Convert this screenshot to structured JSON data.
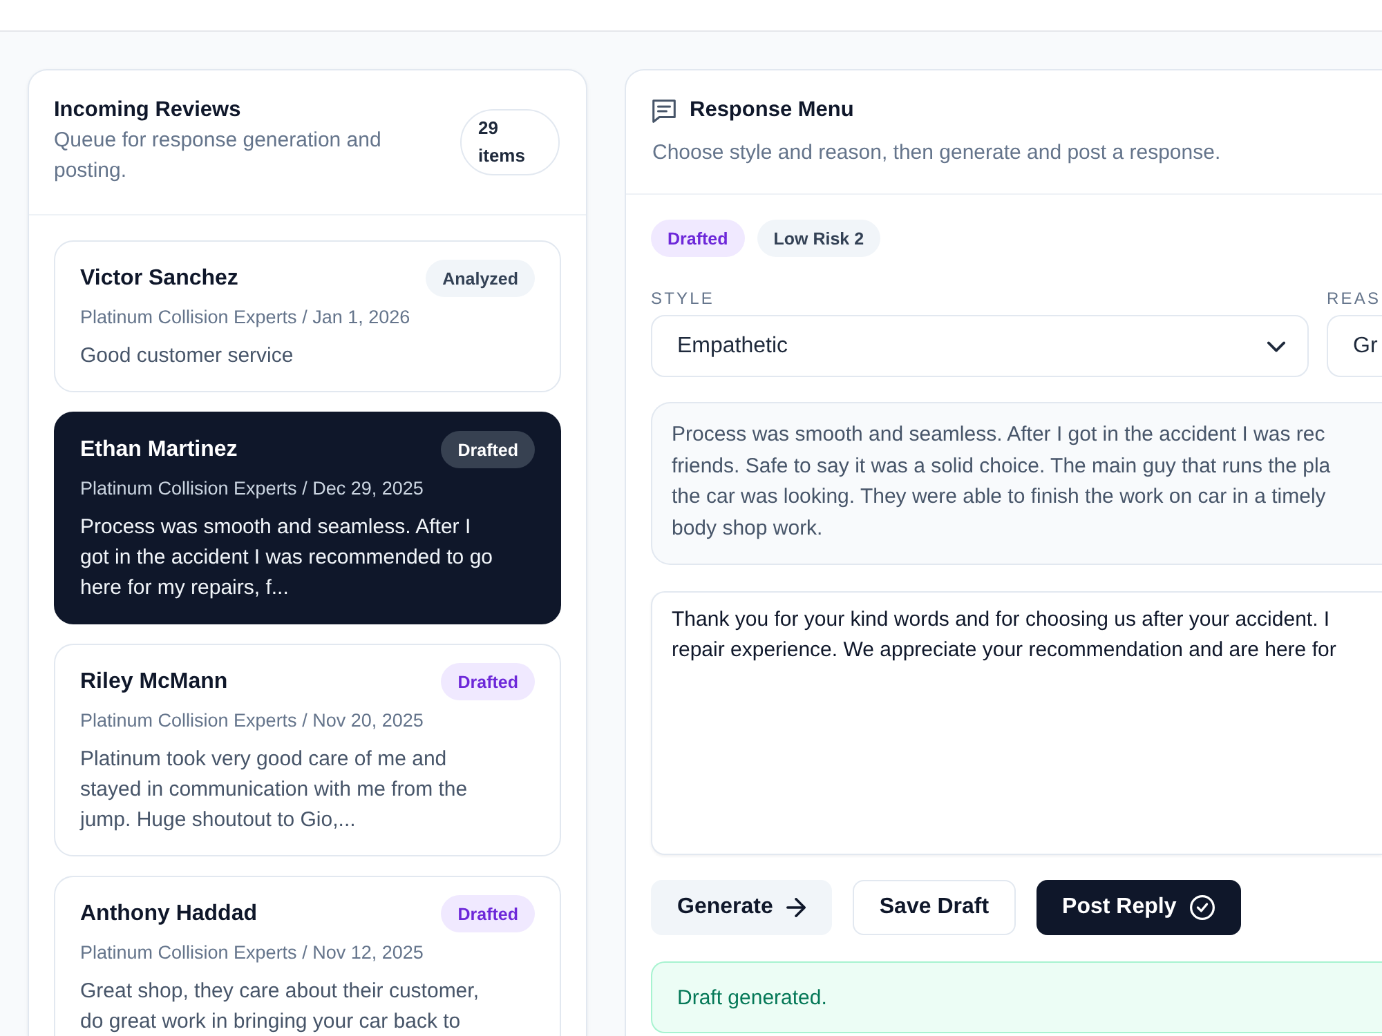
{
  "reviews_panel": {
    "title": "Incoming Reviews",
    "subtitle": "Queue for response generation and posting.",
    "count": "29 items"
  },
  "reviews": [
    {
      "name": "Victor Sanchez",
      "status": {
        "label": "Analyzed",
        "kind": "analyzed"
      },
      "meta": "Platinum Collision Experts / Jan 1, 2026",
      "snippet_lines": [
        "Good customer service"
      ],
      "selected": false
    },
    {
      "name": "Ethan Martinez",
      "status": {
        "label": "Drafted",
        "kind": "drafted"
      },
      "meta": "Platinum Collision Experts / Dec 29, 2025",
      "snippet_lines": [
        "Process was smooth and seamless. After I",
        "got in the accident I was recommended to go",
        "here for my repairs, f..."
      ],
      "selected": true
    },
    {
      "name": "Riley McMann",
      "status": {
        "label": "Drafted",
        "kind": "drafted"
      },
      "meta": "Platinum Collision Experts / Nov 20, 2025",
      "snippet_lines": [
        "Platinum took very good care of me and",
        "stayed in communication with me from the",
        "jump. Huge shoutout to Gio,..."
      ],
      "selected": false
    },
    {
      "name": "Anthony Haddad",
      "status": {
        "label": "Drafted",
        "kind": "drafted"
      },
      "meta": "Platinum Collision Experts / Nov 12, 2025",
      "snippet_lines": [
        "Great shop, they care about their customer,",
        "do great work in bringing your car back to"
      ],
      "selected": false
    }
  ],
  "response_panel": {
    "title": "Response Menu",
    "subtitle": "Choose style and reason, then generate and post a response.",
    "chips": [
      {
        "label": "Drafted",
        "kind": "drafted"
      },
      {
        "label": "Low Risk 2",
        "kind": "risk"
      }
    ],
    "style_select": {
      "label": "STYLE",
      "value": "Empathetic"
    },
    "reason_select": {
      "label": "REAS",
      "value": "Gr"
    },
    "review_text_lines": [
      "Process was smooth and seamless. After I got in the accident I was rec",
      "friends. Safe to say it was a solid choice. The main guy that runs the pla",
      "the car was looking. They were able to finish the work on car in a timely",
      "body shop work."
    ],
    "reply_lines": [
      "Thank you for your kind words and for choosing us after your accident. I",
      "repair experience. We appreciate your recommendation and are here for"
    ],
    "buttons": [
      {
        "label": "Generate",
        "kind": "secondary"
      },
      {
        "label": "Save Draft",
        "kind": "outline"
      },
      {
        "label": "Post Reply",
        "kind": "primary"
      }
    ],
    "alert": {
      "text": "Draft generated.",
      "kind": "success"
    }
  }
}
